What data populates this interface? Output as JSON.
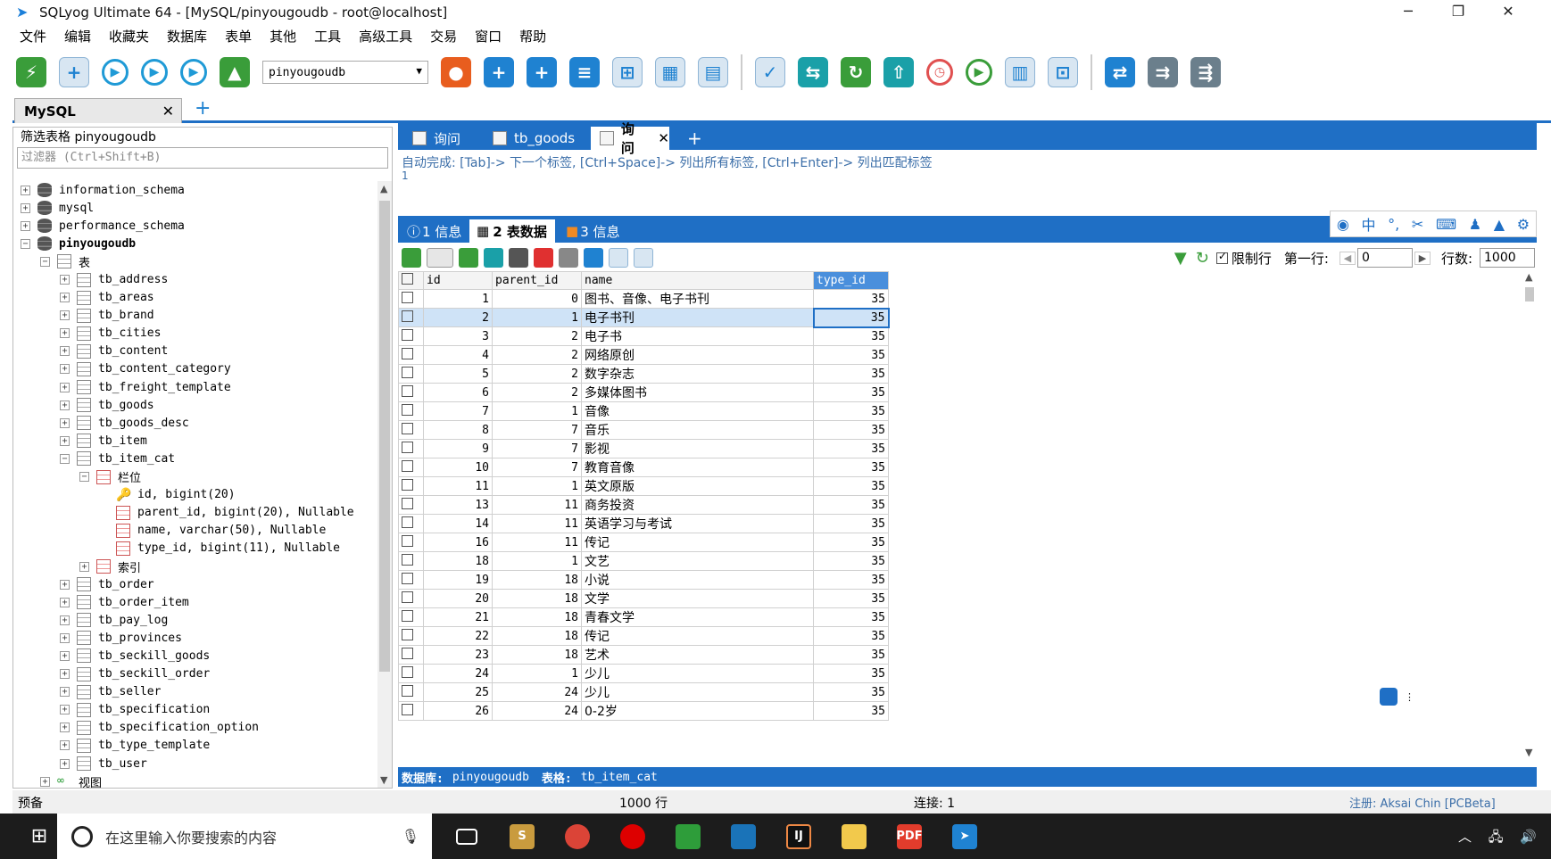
{
  "window": {
    "title": "SQLyog Ultimate 64 - [MySQL/pinyougoudb - root@localhost]",
    "min": "─",
    "max": "❐",
    "close": "✕"
  },
  "menu": [
    "文件",
    "编辑",
    "收藏夹",
    "数据库",
    "表单",
    "其他",
    "工具",
    "高级工具",
    "交易",
    "窗口",
    "帮助"
  ],
  "toolbar": {
    "db_select": "pinyougoudb"
  },
  "connection_tab": {
    "label": "MySQL",
    "close": "✕",
    "add": "+"
  },
  "object_browser": {
    "header": "筛选表格 pinyougoudb",
    "filter_placeholder": "过滤器 (Ctrl+Shift+B)",
    "databases": [
      "information_schema",
      "mysql",
      "performance_schema",
      "pinyougoudb"
    ],
    "tables_label": "表",
    "tables_before": [
      "tb_address",
      "tb_areas",
      "tb_brand",
      "tb_cities",
      "tb_content",
      "tb_content_category",
      "tb_freight_template",
      "tb_goods",
      "tb_goods_desc",
      "tb_item",
      "tb_item_cat"
    ],
    "columns_label": "栏位",
    "columns": [
      "id, bigint(20)",
      "parent_id, bigint(20), Nullable",
      "name, varchar(50), Nullable",
      "type_id, bigint(11), Nullable"
    ],
    "index_label": "索引",
    "tables_after": [
      "tb_order",
      "tb_order_item",
      "tb_pay_log",
      "tb_provinces",
      "tb_seckill_goods",
      "tb_seckill_order",
      "tb_seller",
      "tb_specification",
      "tb_specification_option",
      "tb_type_template",
      "tb_user"
    ],
    "views_label": "视图"
  },
  "query_tabs": [
    {
      "label": "询问"
    },
    {
      "label": "tb_goods"
    },
    {
      "label": "询问",
      "close": "✕"
    }
  ],
  "query_add": "+",
  "autocomplete_hint": "自动完成: [Tab]-> 下一个标签, [Ctrl+Space]-> 列出所有标签, [Ctrl+Enter]-> 列出匹配标签",
  "editor_line": "1",
  "result_tabs": [
    "1 信息",
    "2 表数据",
    "3 信息"
  ],
  "result_toolbar": {
    "limit_label": "限制行",
    "first_row_label": "第一行:",
    "first_row_value": "0",
    "rows_label": "行数:",
    "rows_value": "1000"
  },
  "grid": {
    "columns": [
      "id",
      "parent_id",
      "name",
      "type_id"
    ],
    "rows": [
      [
        "1",
        "0",
        "图书、音像、电子书刊",
        "35"
      ],
      [
        "2",
        "1",
        "电子书刊",
        "35"
      ],
      [
        "3",
        "2",
        "电子书",
        "35"
      ],
      [
        "4",
        "2",
        "网络原创",
        "35"
      ],
      [
        "5",
        "2",
        "数字杂志",
        "35"
      ],
      [
        "6",
        "2",
        "多媒体图书",
        "35"
      ],
      [
        "7",
        "1",
        "音像",
        "35"
      ],
      [
        "8",
        "7",
        "音乐",
        "35"
      ],
      [
        "9",
        "7",
        "影视",
        "35"
      ],
      [
        "10",
        "7",
        "教育音像",
        "35"
      ],
      [
        "11",
        "1",
        "英文原版",
        "35"
      ],
      [
        "13",
        "11",
        "商务投资",
        "35"
      ],
      [
        "14",
        "11",
        "英语学习与考试",
        "35"
      ],
      [
        "16",
        "11",
        "传记",
        "35"
      ],
      [
        "18",
        "1",
        "文艺",
        "35"
      ],
      [
        "19",
        "18",
        "小说",
        "35"
      ],
      [
        "20",
        "18",
        "文学",
        "35"
      ],
      [
        "21",
        "18",
        "青春文学",
        "35"
      ],
      [
        "22",
        "18",
        "传记",
        "35"
      ],
      [
        "23",
        "18",
        "艺术",
        "35"
      ],
      [
        "24",
        "1",
        "少儿",
        "35"
      ],
      [
        "25",
        "24",
        "少儿",
        "35"
      ],
      [
        "26",
        "24",
        "0-2岁",
        "35"
      ]
    ]
  },
  "db_status": {
    "db_label": "数据库:",
    "db": "pinyougoudb",
    "table_label": "表格:",
    "table": "tb_item_cat"
  },
  "bottom": {
    "left": "预备",
    "rows": "1000 行",
    "conn": "连接: 1",
    "reg": "注册: Aksai Chin [PCBeta]"
  },
  "taskbar": {
    "search_placeholder": "在这里输入你要搜索的内容"
  },
  "colors": {
    "accent": "#1f6fc5",
    "selected_row": "#cfe3f7"
  }
}
